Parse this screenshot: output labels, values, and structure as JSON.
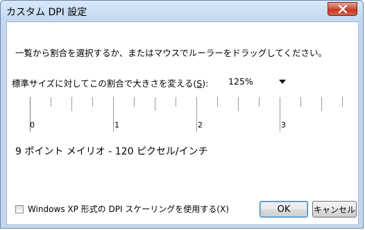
{
  "window": {
    "title": "カスタム DPI 設定"
  },
  "instruction": "一覧から割合を選択するか、またはマウスでルーラーをドラッグしてください。",
  "scale": {
    "label_before": "標準サイズに対してこの割合で大きさを変える(",
    "label_key": "S",
    "label_after": "):",
    "selected_value": "125%"
  },
  "ruler": {
    "labels": [
      "0",
      "1",
      "2",
      "3"
    ]
  },
  "font_info": "9 ポイント メイリオ - 120 ピクセル/インチ",
  "checkbox": {
    "label": "Windows XP 形式の DPI スケーリングを使用する(X)",
    "checked": false
  },
  "buttons": {
    "ok": "OK",
    "cancel": "キャンセル"
  },
  "icons": {
    "close": "close-icon",
    "dropdown": "chevron-down-icon"
  }
}
